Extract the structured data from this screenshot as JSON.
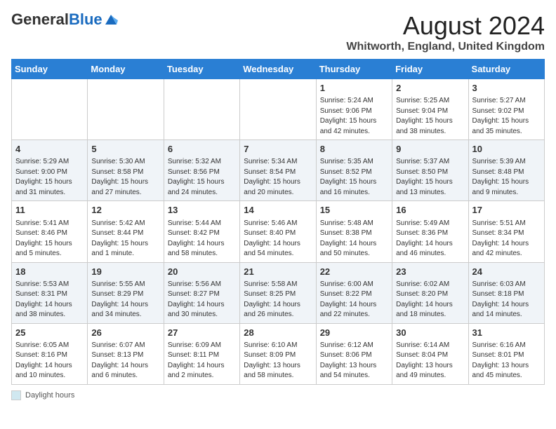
{
  "header": {
    "logo_general": "General",
    "logo_blue": "Blue",
    "title": "August 2024",
    "subtitle": "Whitworth, England, United Kingdom"
  },
  "weekdays": [
    "Sunday",
    "Monday",
    "Tuesday",
    "Wednesday",
    "Thursday",
    "Friday",
    "Saturday"
  ],
  "weeks": [
    [
      {
        "day": "",
        "info": ""
      },
      {
        "day": "",
        "info": ""
      },
      {
        "day": "",
        "info": ""
      },
      {
        "day": "",
        "info": ""
      },
      {
        "day": "1",
        "info": "Sunrise: 5:24 AM\nSunset: 9:06 PM\nDaylight: 15 hours\nand 42 minutes."
      },
      {
        "day": "2",
        "info": "Sunrise: 5:25 AM\nSunset: 9:04 PM\nDaylight: 15 hours\nand 38 minutes."
      },
      {
        "day": "3",
        "info": "Sunrise: 5:27 AM\nSunset: 9:02 PM\nDaylight: 15 hours\nand 35 minutes."
      }
    ],
    [
      {
        "day": "4",
        "info": "Sunrise: 5:29 AM\nSunset: 9:00 PM\nDaylight: 15 hours\nand 31 minutes."
      },
      {
        "day": "5",
        "info": "Sunrise: 5:30 AM\nSunset: 8:58 PM\nDaylight: 15 hours\nand 27 minutes."
      },
      {
        "day": "6",
        "info": "Sunrise: 5:32 AM\nSunset: 8:56 PM\nDaylight: 15 hours\nand 24 minutes."
      },
      {
        "day": "7",
        "info": "Sunrise: 5:34 AM\nSunset: 8:54 PM\nDaylight: 15 hours\nand 20 minutes."
      },
      {
        "day": "8",
        "info": "Sunrise: 5:35 AM\nSunset: 8:52 PM\nDaylight: 15 hours\nand 16 minutes."
      },
      {
        "day": "9",
        "info": "Sunrise: 5:37 AM\nSunset: 8:50 PM\nDaylight: 15 hours\nand 13 minutes."
      },
      {
        "day": "10",
        "info": "Sunrise: 5:39 AM\nSunset: 8:48 PM\nDaylight: 15 hours\nand 9 minutes."
      }
    ],
    [
      {
        "day": "11",
        "info": "Sunrise: 5:41 AM\nSunset: 8:46 PM\nDaylight: 15 hours\nand 5 minutes."
      },
      {
        "day": "12",
        "info": "Sunrise: 5:42 AM\nSunset: 8:44 PM\nDaylight: 15 hours\nand 1 minute."
      },
      {
        "day": "13",
        "info": "Sunrise: 5:44 AM\nSunset: 8:42 PM\nDaylight: 14 hours\nand 58 minutes."
      },
      {
        "day": "14",
        "info": "Sunrise: 5:46 AM\nSunset: 8:40 PM\nDaylight: 14 hours\nand 54 minutes."
      },
      {
        "day": "15",
        "info": "Sunrise: 5:48 AM\nSunset: 8:38 PM\nDaylight: 14 hours\nand 50 minutes."
      },
      {
        "day": "16",
        "info": "Sunrise: 5:49 AM\nSunset: 8:36 PM\nDaylight: 14 hours\nand 46 minutes."
      },
      {
        "day": "17",
        "info": "Sunrise: 5:51 AM\nSunset: 8:34 PM\nDaylight: 14 hours\nand 42 minutes."
      }
    ],
    [
      {
        "day": "18",
        "info": "Sunrise: 5:53 AM\nSunset: 8:31 PM\nDaylight: 14 hours\nand 38 minutes."
      },
      {
        "day": "19",
        "info": "Sunrise: 5:55 AM\nSunset: 8:29 PM\nDaylight: 14 hours\nand 34 minutes."
      },
      {
        "day": "20",
        "info": "Sunrise: 5:56 AM\nSunset: 8:27 PM\nDaylight: 14 hours\nand 30 minutes."
      },
      {
        "day": "21",
        "info": "Sunrise: 5:58 AM\nSunset: 8:25 PM\nDaylight: 14 hours\nand 26 minutes."
      },
      {
        "day": "22",
        "info": "Sunrise: 6:00 AM\nSunset: 8:22 PM\nDaylight: 14 hours\nand 22 minutes."
      },
      {
        "day": "23",
        "info": "Sunrise: 6:02 AM\nSunset: 8:20 PM\nDaylight: 14 hours\nand 18 minutes."
      },
      {
        "day": "24",
        "info": "Sunrise: 6:03 AM\nSunset: 8:18 PM\nDaylight: 14 hours\nand 14 minutes."
      }
    ],
    [
      {
        "day": "25",
        "info": "Sunrise: 6:05 AM\nSunset: 8:16 PM\nDaylight: 14 hours\nand 10 minutes."
      },
      {
        "day": "26",
        "info": "Sunrise: 6:07 AM\nSunset: 8:13 PM\nDaylight: 14 hours\nand 6 minutes."
      },
      {
        "day": "27",
        "info": "Sunrise: 6:09 AM\nSunset: 8:11 PM\nDaylight: 14 hours\nand 2 minutes."
      },
      {
        "day": "28",
        "info": "Sunrise: 6:10 AM\nSunset: 8:09 PM\nDaylight: 13 hours\nand 58 minutes."
      },
      {
        "day": "29",
        "info": "Sunrise: 6:12 AM\nSunset: 8:06 PM\nDaylight: 13 hours\nand 54 minutes."
      },
      {
        "day": "30",
        "info": "Sunrise: 6:14 AM\nSunset: 8:04 PM\nDaylight: 13 hours\nand 49 minutes."
      },
      {
        "day": "31",
        "info": "Sunrise: 6:16 AM\nSunset: 8:01 PM\nDaylight: 13 hours\nand 45 minutes."
      }
    ]
  ],
  "footer": {
    "daylight_label": "Daylight hours"
  }
}
